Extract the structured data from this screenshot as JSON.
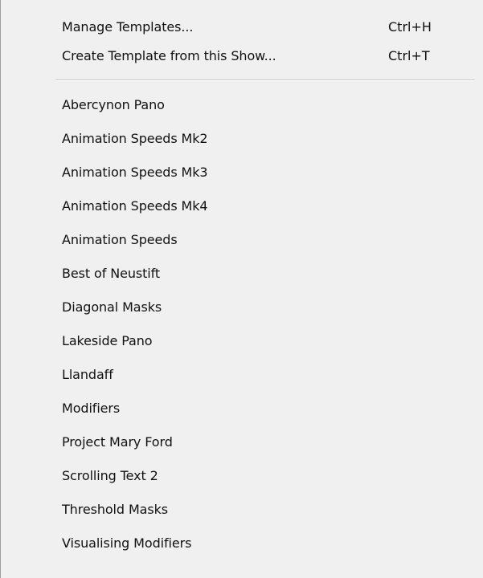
{
  "menu": {
    "commands": [
      {
        "label": "Manage Templates...",
        "shortcut": "Ctrl+H"
      },
      {
        "label": "Create Template from this Show...",
        "shortcut": "Ctrl+T"
      }
    ],
    "templates": [
      {
        "label": "Abercynon Pano"
      },
      {
        "label": "Animation Speeds Mk2"
      },
      {
        "label": "Animation Speeds Mk3"
      },
      {
        "label": "Animation Speeds Mk4"
      },
      {
        "label": "Animation Speeds"
      },
      {
        "label": "Best of Neustift"
      },
      {
        "label": "Diagonal Masks"
      },
      {
        "label": "Lakeside Pano"
      },
      {
        "label": "Llandaff"
      },
      {
        "label": "Modifiers"
      },
      {
        "label": "Project Mary Ford"
      },
      {
        "label": "Scrolling Text 2"
      },
      {
        "label": "Threshold Masks"
      },
      {
        "label": "Visualising Modifiers"
      }
    ]
  }
}
